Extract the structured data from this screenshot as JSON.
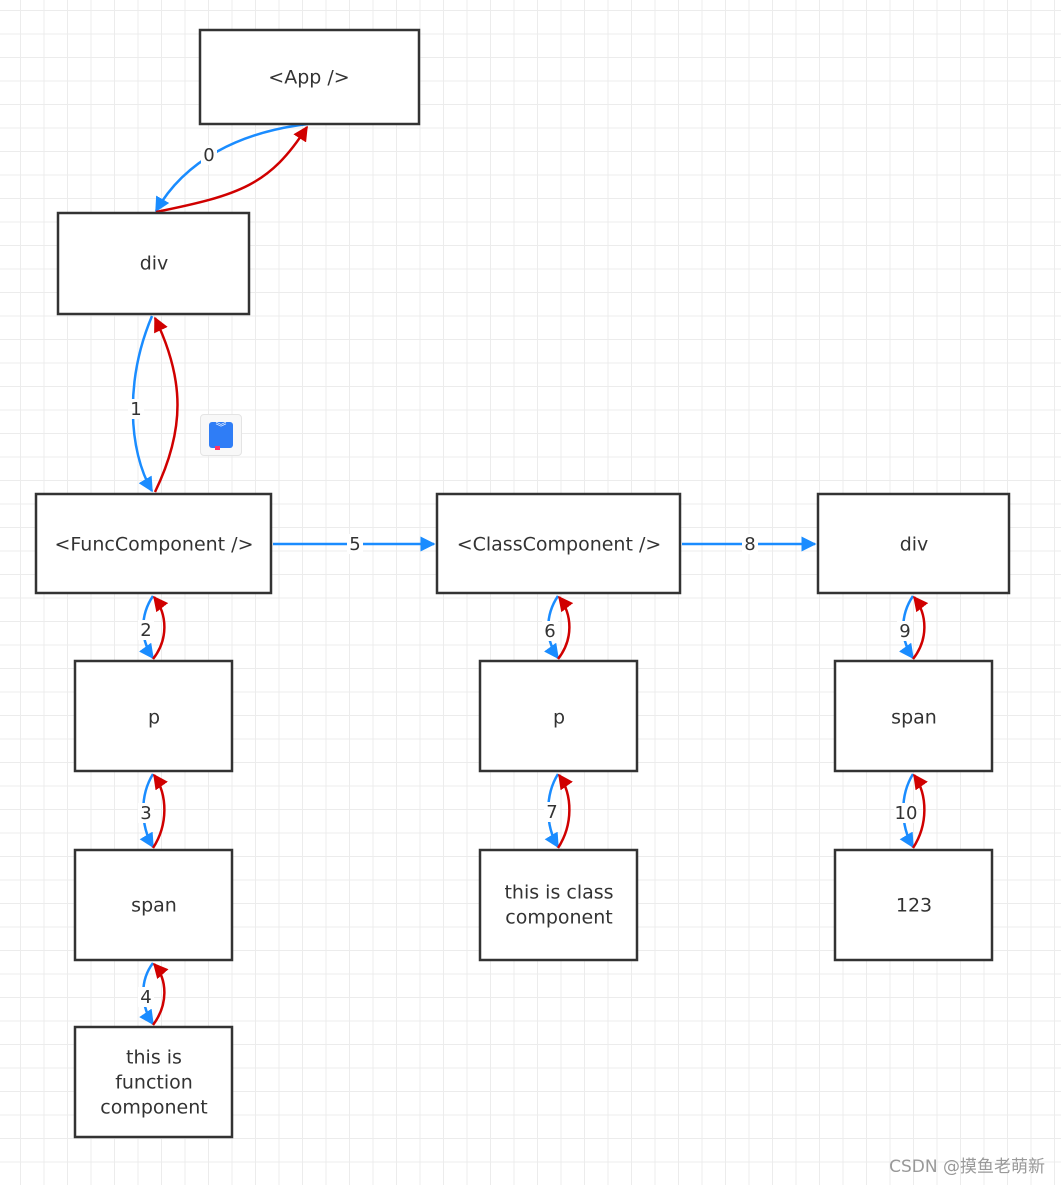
{
  "nodes": {
    "app": "<App />",
    "div": "div",
    "func": "<FuncComponent />",
    "class": "<ClassComponent />",
    "div2": "div",
    "p1": "p",
    "span1": "span",
    "text1": [
      "this is",
      "function",
      "component"
    ],
    "p2": "p",
    "text2": [
      "this is class",
      "component"
    ],
    "span2": "span",
    "num": "123"
  },
  "edges": [
    "0",
    "1",
    "2",
    "3",
    "4",
    "5",
    "6",
    "7",
    "8",
    "9",
    "10"
  ],
  "colors": {
    "child_edge": "#1a8cff",
    "return_edge": "#d00000",
    "node_border": "#333333"
  },
  "icons": {
    "floating": "book-icon"
  },
  "watermark": "CSDN @摸鱼老萌新"
}
